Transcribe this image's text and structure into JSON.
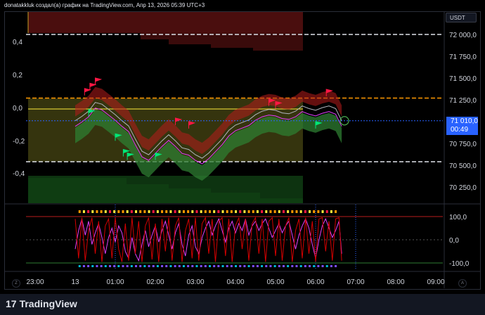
{
  "header": {
    "text": "donatakkluk создал(а) график на TradingView.com, Апр 13, 2026 05:39 UTC+3"
  },
  "currency_button": {
    "label": "USDT"
  },
  "last_price": {
    "value": "71 010,0",
    "countdown": "00:49"
  },
  "footer": {
    "logo_text": "TradingView",
    "left_corner": "Z",
    "right_corner": "A"
  },
  "colors": {
    "price_line": "#2962ff",
    "indicator_magenta": "#e040fb",
    "indicator_red": "#d50000",
    "green_band": "#4caf50",
    "red_band": "#e53935",
    "yellow_line": "#ffeb3b"
  },
  "chart_data": [
    {
      "type": "line",
      "pane": "main",
      "title": "",
      "left_axis_ticks": [
        "0,4",
        "0,2",
        "0,0",
        "-0,2",
        "-0,4"
      ],
      "right_axis_ticks": [
        "72 000,0",
        "71 750,0",
        "71 500,0",
        "71 250,0",
        "71 000,0",
        "70 750,0",
        "70 500,0",
        "70 250,0"
      ],
      "x_ticks": [
        "23:00",
        "13",
        "01:00",
        "02:00",
        "03:00",
        "04:00",
        "05:00",
        "06:00",
        "07:00",
        "08:00",
        "09:00"
      ],
      "ylim": [
        70100,
        72100
      ],
      "horizontal_levels": [
        72000,
        71270,
        70540
      ],
      "series": [
        {
          "values": [
            [
              -60,
              71010
            ],
            [
              -50,
              71060
            ],
            [
              -40,
              71120
            ],
            [
              -30,
              71220
            ],
            [
              -20,
              71200
            ],
            [
              -10,
              71140
            ],
            [
              0,
              71080
            ],
            [
              10,
              71010
            ],
            [
              20,
              70950
            ],
            [
              30,
              70800
            ],
            [
              40,
              70660
            ],
            [
              50,
              70620
            ],
            [
              60,
              70700
            ],
            [
              70,
              70780
            ],
            [
              80,
              70850
            ],
            [
              90,
              70780
            ],
            [
              100,
              70700
            ],
            [
              110,
              70680
            ],
            [
              120,
              70620
            ],
            [
              130,
              70580
            ],
            [
              140,
              70640
            ],
            [
              150,
              70720
            ],
            [
              160,
              70800
            ],
            [
              170,
              70900
            ],
            [
              180,
              70960
            ],
            [
              190,
              70990
            ],
            [
              200,
              71020
            ],
            [
              210,
              71080
            ],
            [
              220,
              71120
            ],
            [
              230,
              71140
            ],
            [
              240,
              71130
            ],
            [
              250,
              71100
            ],
            [
              260,
              71090
            ],
            [
              270,
              71120
            ],
            [
              280,
              71180
            ],
            [
              290,
              71150
            ],
            [
              300,
              71130
            ],
            [
              310,
              71160
            ],
            [
              320,
              71180
            ],
            [
              330,
              71150
            ],
            [
              339,
              71010
            ]
          ]
        }
      ]
    },
    {
      "type": "line",
      "pane": "oscillator",
      "y_ticks": [
        "100,0",
        "0,0",
        "-100,0"
      ],
      "ylim": [
        -130,
        130
      ],
      "series": [
        {
          "values": [
            [
              -60,
              -40
            ],
            [
              -55,
              40
            ],
            [
              -50,
              90
            ],
            [
              -45,
              20
            ],
            [
              -40,
              80
            ],
            [
              -35,
              -20
            ],
            [
              -30,
              30
            ],
            [
              -25,
              70
            ],
            [
              -20,
              10
            ],
            [
              -15,
              -60
            ],
            [
              -10,
              10
            ],
            [
              -5,
              50
            ],
            [
              0,
              -10
            ],
            [
              5,
              60
            ],
            [
              10,
              30
            ],
            [
              15,
              -50
            ],
            [
              20,
              -80
            ],
            [
              25,
              10
            ],
            [
              30,
              -60
            ],
            [
              35,
              -90
            ],
            [
              40,
              -20
            ],
            [
              45,
              40
            ],
            [
              50,
              -30
            ],
            [
              55,
              20
            ],
            [
              60,
              60
            ],
            [
              65,
              -10
            ],
            [
              70,
              40
            ],
            [
              75,
              80
            ],
            [
              80,
              20
            ],
            [
              85,
              -40
            ],
            [
              90,
              30
            ],
            [
              95,
              70
            ],
            [
              100,
              -20
            ],
            [
              105,
              -70
            ],
            [
              110,
              20
            ],
            [
              115,
              60
            ],
            [
              120,
              -30
            ],
            [
              125,
              -60
            ],
            [
              130,
              10
            ],
            [
              135,
              50
            ],
            [
              140,
              80
            ],
            [
              145,
              20
            ],
            [
              150,
              60
            ],
            [
              155,
              90
            ],
            [
              160,
              40
            ],
            [
              165,
              -10
            ],
            [
              170,
              50
            ],
            [
              175,
              80
            ],
            [
              180,
              30
            ],
            [
              185,
              70
            ],
            [
              190,
              40
            ],
            [
              195,
              90
            ],
            [
              200,
              20
            ],
            [
              205,
              60
            ],
            [
              210,
              80
            ],
            [
              215,
              40
            ],
            [
              220,
              70
            ],
            [
              225,
              90
            ],
            [
              230,
              50
            ],
            [
              235,
              10
            ],
            [
              240,
              40
            ],
            [
              245,
              70
            ],
            [
              250,
              30
            ],
            [
              255,
              60
            ],
            [
              260,
              80
            ],
            [
              265,
              20
            ],
            [
              270,
              -40
            ],
            [
              275,
              20
            ],
            [
              280,
              60
            ],
            [
              285,
              90
            ],
            [
              290,
              50
            ],
            [
              295,
              -20
            ],
            [
              300,
              -80
            ],
            [
              305,
              0
            ],
            [
              310,
              60
            ],
            [
              315,
              90
            ],
            [
              320,
              50
            ],
            [
              325,
              10
            ],
            [
              330,
              40
            ],
            [
              335,
              80
            ],
            [
              339,
              -60
            ]
          ]
        },
        {
          "values": [
            [
              -60,
              90
            ],
            [
              -55,
              -80
            ],
            [
              -50,
              95
            ],
            [
              -45,
              -90
            ],
            [
              -40,
              40
            ],
            [
              -35,
              95
            ],
            [
              -30,
              -60
            ],
            [
              -25,
              80
            ],
            [
              -20,
              -95
            ],
            [
              -15,
              60
            ],
            [
              -10,
              90
            ],
            [
              -5,
              -80
            ],
            [
              0,
              95
            ],
            [
              5,
              -40
            ],
            [
              10,
              -95
            ],
            [
              15,
              70
            ],
            [
              20,
              -90
            ],
            [
              25,
              95
            ],
            [
              30,
              -60
            ],
            [
              35,
              80
            ],
            [
              40,
              -95
            ],
            [
              45,
              60
            ],
            [
              50,
              95
            ],
            [
              55,
              -85
            ],
            [
              60,
              70
            ],
            [
              65,
              -95
            ],
            [
              70,
              90
            ],
            [
              75,
              -50
            ],
            [
              80,
              95
            ],
            [
              85,
              -90
            ],
            [
              90,
              60
            ],
            [
              95,
              95
            ],
            [
              100,
              -95
            ],
            [
              105,
              40
            ],
            [
              110,
              90
            ],
            [
              115,
              -80
            ],
            [
              120,
              95
            ],
            [
              125,
              -90
            ],
            [
              130,
              70
            ],
            [
              135,
              95
            ],
            [
              140,
              -60
            ],
            [
              145,
              90
            ],
            [
              150,
              -95
            ],
            [
              155,
              80
            ],
            [
              160,
              95
            ],
            [
              165,
              -70
            ],
            [
              170,
              90
            ],
            [
              175,
              -95
            ],
            [
              180,
              60
            ],
            [
              185,
              95
            ],
            [
              190,
              -40
            ],
            [
              195,
              90
            ],
            [
              200,
              -90
            ],
            [
              205,
              70
            ],
            [
              210,
              95
            ],
            [
              215,
              -60
            ],
            [
              220,
              90
            ],
            [
              225,
              -95
            ],
            [
              230,
              80
            ],
            [
              235,
              95
            ],
            [
              240,
              -70
            ],
            [
              245,
              90
            ],
            [
              250,
              -90
            ],
            [
              255,
              60
            ],
            [
              260,
              95
            ],
            [
              265,
              -95
            ],
            [
              270,
              40
            ],
            [
              275,
              90
            ],
            [
              280,
              -80
            ],
            [
              285,
              95
            ],
            [
              290,
              -60
            ],
            [
              295,
              80
            ],
            [
              300,
              -95
            ],
            [
              305,
              90
            ],
            [
              310,
              95
            ],
            [
              315,
              -50
            ],
            [
              320,
              80
            ],
            [
              325,
              -90
            ],
            [
              330,
              90
            ],
            [
              335,
              95
            ],
            [
              339,
              -90
            ]
          ]
        }
      ]
    }
  ]
}
